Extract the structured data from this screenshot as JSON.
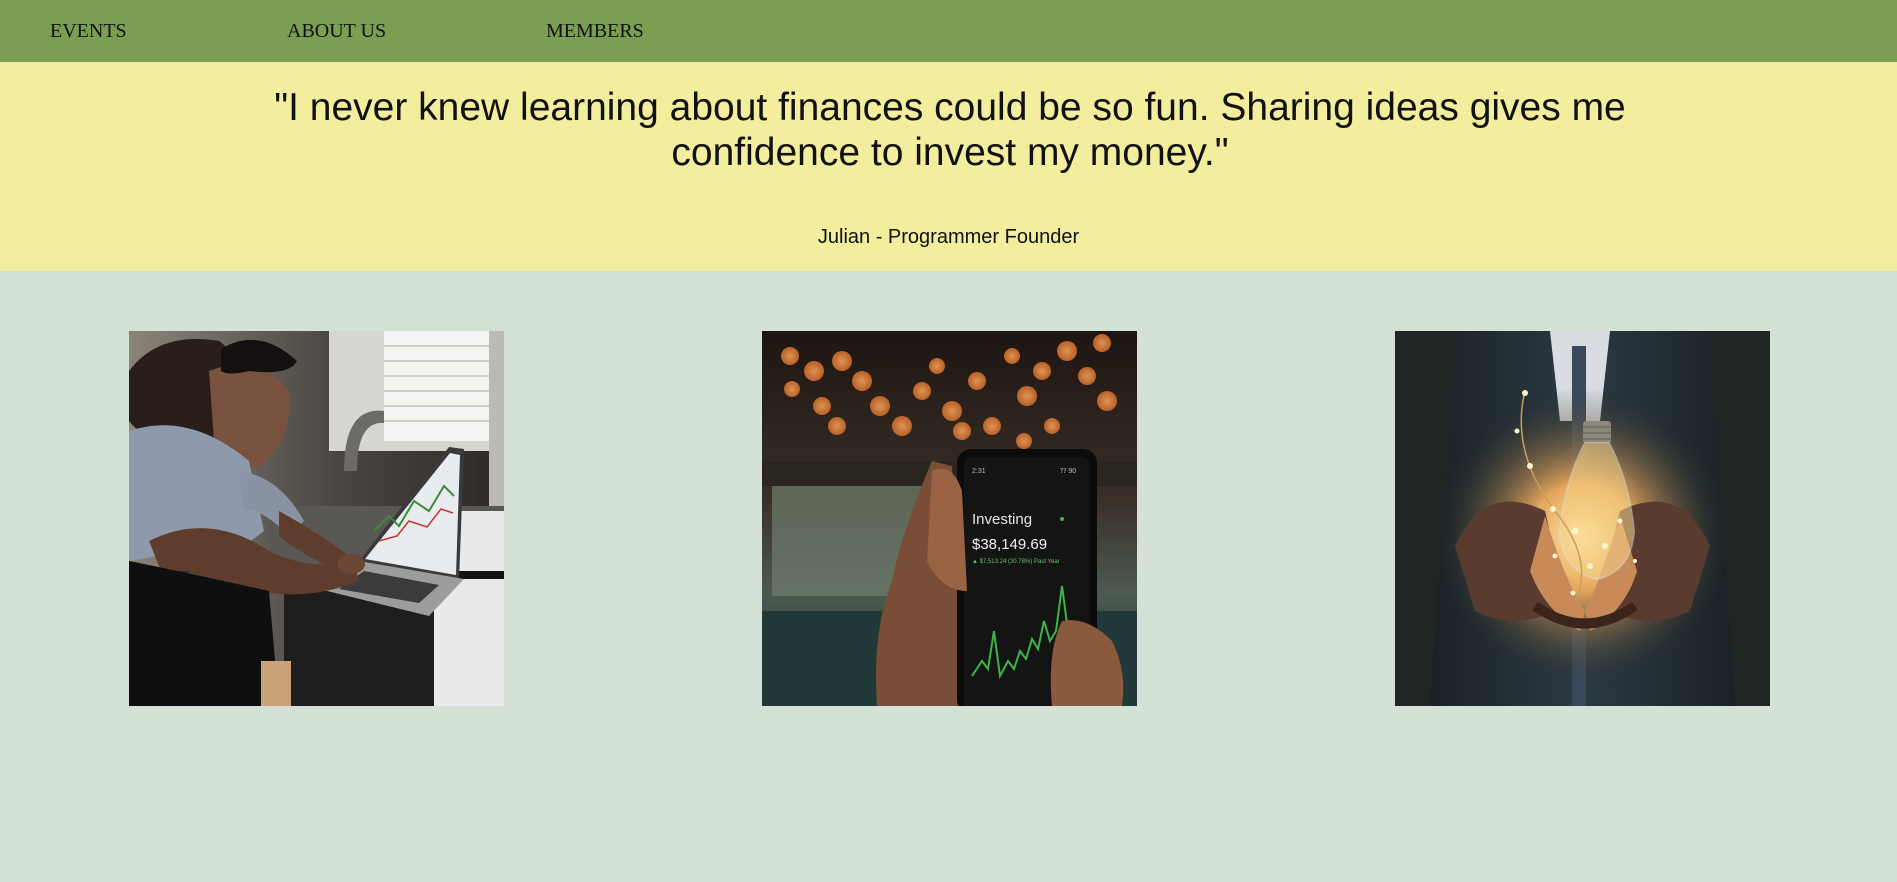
{
  "nav": {
    "items": [
      {
        "label": "EVENTS"
      },
      {
        "label": "ABOUT US"
      },
      {
        "label": "MEMBERS"
      }
    ]
  },
  "testimonial": {
    "quote": "\"I never knew learning about finances could be so fun. Sharing ideas gives me confidence to invest my money.\"",
    "author": "Julian - Programmer Founder"
  },
  "gallery": {
    "photos": [
      {
        "subject": "man-at-laptop-photo"
      },
      {
        "subject": "phone-investing-app-photo",
        "phone_title": "Investing",
        "phone_value": "$38,149.69",
        "phone_change": "▲ $7,513.24 (20.78%) Past Year"
      },
      {
        "subject": "hands-holding-lightbulb-photo"
      }
    ]
  },
  "colors": {
    "nav_bg": "#7a9e52",
    "quote_bg": "#f3ed9e",
    "page_bg": "#d3e2d4"
  }
}
